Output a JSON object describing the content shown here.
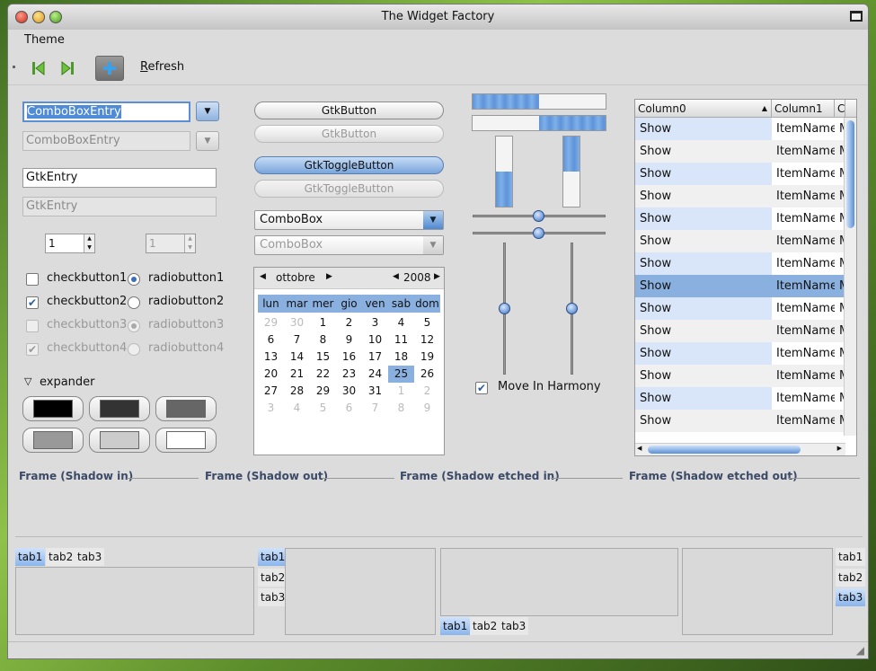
{
  "window": {
    "title": "The Widget Factory"
  },
  "menu": {
    "theme": "Theme"
  },
  "toolbar": {
    "refresh_label": "Refresh",
    "refresh_mnemonic": "R",
    "refresh_rest": "efresh"
  },
  "left": {
    "combo_entry_value": "ComboBoxEntry",
    "combo_entry_disabled_value": "ComboBoxEntry",
    "entry_value": "GtkEntry",
    "entry_disabled_value": "GtkEntry",
    "spin_value": "1",
    "spin_disabled_value": "1",
    "checks": [
      "checkbutton1",
      "checkbutton2",
      "checkbutton3",
      "checkbutton4"
    ],
    "radios": [
      "radiobutton1",
      "radiobutton2",
      "radiobutton3",
      "radiobutton4"
    ],
    "expander_label": "expander",
    "swatch_colors": [
      "#000000",
      "#333333",
      "#666666",
      "#999999",
      "#cccccc",
      "#ffffff"
    ]
  },
  "middle": {
    "button": "GtkButton",
    "button_disabled": "GtkButton",
    "toggle": "GtkToggleButton",
    "toggle_disabled": "GtkToggleButton",
    "combo": "ComboBox",
    "combo_disabled": "ComboBox",
    "calendar": {
      "month": "ottobre",
      "year": "2008",
      "days": [
        "lun",
        "mar",
        "mer",
        "gio",
        "ven",
        "sab",
        "dom"
      ],
      "weeks": [
        [
          "29",
          "30",
          "1",
          "2",
          "3",
          "4",
          "5"
        ],
        [
          "6",
          "7",
          "8",
          "9",
          "10",
          "11",
          "12"
        ],
        [
          "13",
          "14",
          "15",
          "16",
          "17",
          "18",
          "19"
        ],
        [
          "20",
          "21",
          "22",
          "23",
          "24",
          "25",
          "26"
        ],
        [
          "27",
          "28",
          "29",
          "30",
          "31",
          "1",
          "2"
        ],
        [
          "3",
          "4",
          "5",
          "6",
          "7",
          "8",
          "9"
        ]
      ],
      "selected_day": "25"
    }
  },
  "right": {
    "move_in_harmony": "Move In Harmony",
    "progress": {
      "h1": 0.5,
      "h2": 0.5,
      "v1": 0.5,
      "v2": 0.5
    },
    "tree": {
      "columns": [
        "Column0",
        "Column1",
        "C"
      ],
      "rows": [
        [
          "Show",
          "ItemName",
          "M"
        ],
        [
          "Show",
          "ItemName",
          "M"
        ],
        [
          "Show",
          "ItemName",
          "M"
        ],
        [
          "Show",
          "ItemName",
          "M"
        ],
        [
          "Show",
          "ItemName",
          "M"
        ],
        [
          "Show",
          "ItemName",
          "M"
        ],
        [
          "Show",
          "ItemName",
          "M"
        ],
        [
          "Show",
          "ItemName",
          "M"
        ],
        [
          "Show",
          "ItemName",
          "M"
        ],
        [
          "Show",
          "ItemName",
          "M"
        ],
        [
          "Show",
          "ItemName",
          "M"
        ],
        [
          "Show",
          "ItemName",
          "M"
        ],
        [
          "Show",
          "ItemName",
          "M"
        ],
        [
          "Show",
          "ItemName",
          "M"
        ]
      ],
      "selected_row": 7
    }
  },
  "frames": [
    "Frame (Shadow in)",
    "Frame (Shadow out)",
    "Frame (Shadow etched in)",
    "Frame (Shadow etched out)"
  ],
  "tabs": [
    "tab1",
    "tab2",
    "tab3"
  ]
}
